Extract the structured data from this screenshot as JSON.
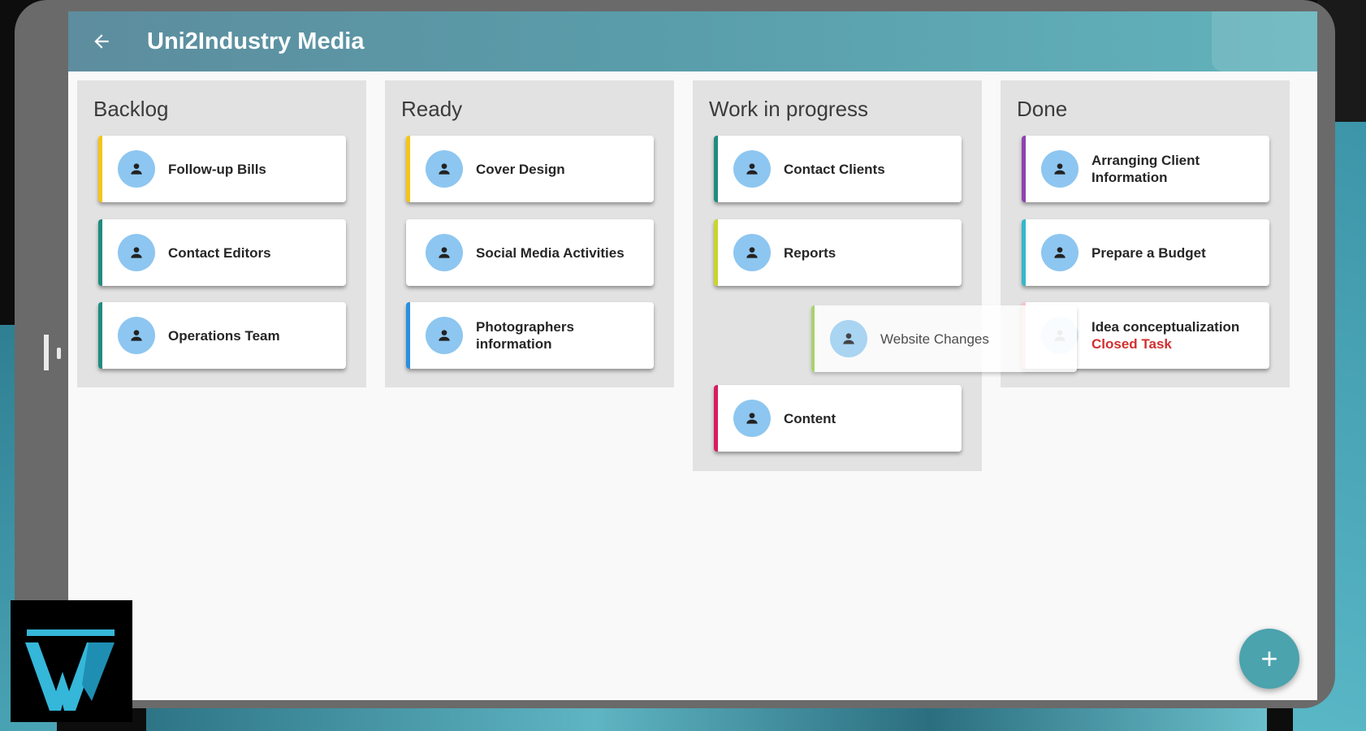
{
  "app": {
    "title": "Uni2Industry Media",
    "back_icon": "arrow-left-icon"
  },
  "colors": {
    "appbar_start": "#5d8d9e",
    "appbar_end": "#62b3bc",
    "avatar": "#8dc6f0",
    "fab": "#4aa3ad",
    "closed_text": "#d32f2f"
  },
  "columns": [
    {
      "title": "Backlog",
      "cards": [
        {
          "label": "Follow-up Bills",
          "accent": "#f5c518"
        },
        {
          "label": "Contact Editors",
          "accent": "#1f8c80"
        },
        {
          "label": "Operations Team",
          "accent": "#1f8c80"
        }
      ]
    },
    {
      "title": "Ready",
      "cards": [
        {
          "label": "Cover Design",
          "accent": "#f5c518"
        },
        {
          "label": "Social Media Activities",
          "accent": "#ffffff"
        },
        {
          "label": "Photographers information",
          "accent": "#2a8fe0"
        }
      ]
    },
    {
      "title": "Work in progress",
      "cards": [
        {
          "label": "Contact Clients",
          "accent": "#1f8c80"
        },
        {
          "label": "Reports",
          "accent": "#c9d52c"
        },
        {
          "label": "Content",
          "accent": "#d81b60"
        }
      ]
    },
    {
      "title": "Done",
      "cards": [
        {
          "label": "Arranging Client Information",
          "accent": "#8e44ad"
        },
        {
          "label": "Prepare a Budget",
          "accent": "#33b8c9"
        },
        {
          "label": "Idea conceptualization",
          "status": "Closed Task",
          "accent": "#f6c6c6"
        }
      ]
    }
  ],
  "dragging_card": {
    "label": "Website Changes",
    "accent": "#a6d36d"
  },
  "fab": {
    "label": "+",
    "icon": "add-icon"
  },
  "logo": {
    "letter": "W",
    "icon": "brand-w-logo"
  }
}
